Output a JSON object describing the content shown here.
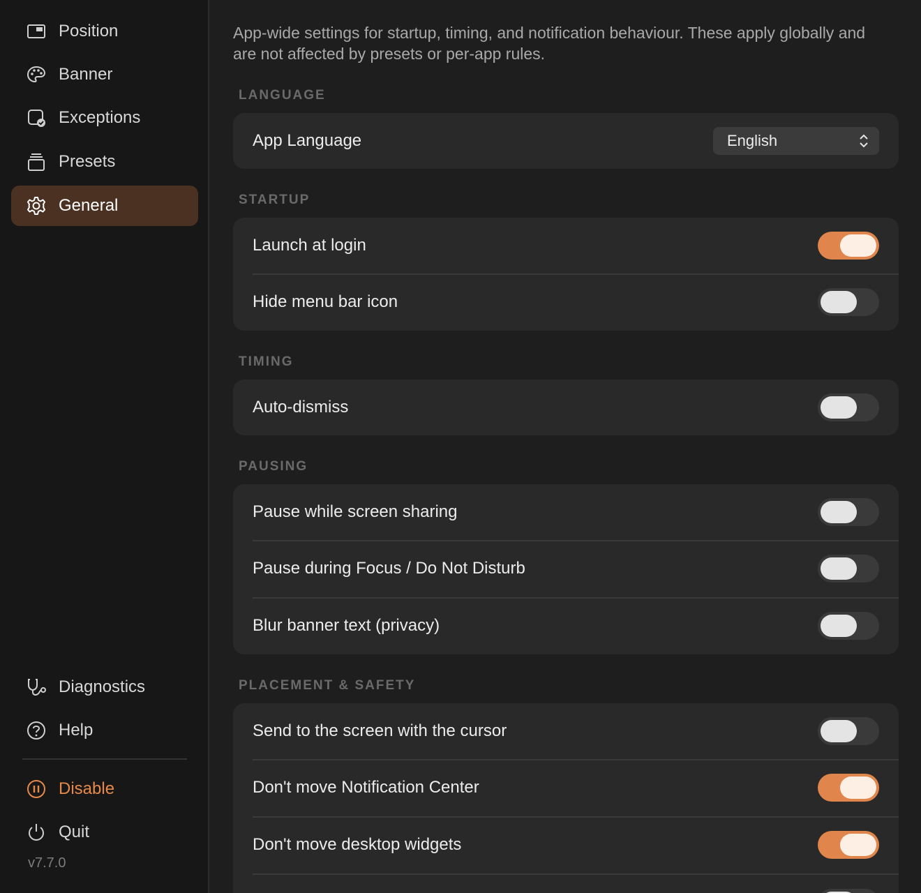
{
  "sidebar": {
    "nav": [
      {
        "label": "Position",
        "icon": "window-position-icon"
      },
      {
        "label": "Banner",
        "icon": "palette-icon"
      },
      {
        "label": "Exceptions",
        "icon": "exceptions-icon"
      },
      {
        "label": "Presets",
        "icon": "stack-icon"
      },
      {
        "label": "General",
        "icon": "gear-icon",
        "active": true
      }
    ],
    "bottom": [
      {
        "label": "Diagnostics",
        "icon": "stethoscope-icon"
      },
      {
        "label": "Help",
        "icon": "help-icon"
      },
      {
        "label": "Disable",
        "icon": "pause-icon"
      },
      {
        "label": "Quit",
        "icon": "power-icon"
      }
    ],
    "version": "v7.7.0"
  },
  "main": {
    "description": "App-wide settings for startup, timing, and notification behaviour. These apply globally and are not affected by presets or per-app rules.",
    "sections": {
      "language": {
        "title": "LANGUAGE",
        "rows": [
          {
            "label": "App Language",
            "select_value": "English"
          }
        ]
      },
      "startup": {
        "title": "STARTUP",
        "rows": [
          {
            "label": "Launch at login",
            "on": true
          },
          {
            "label": "Hide menu bar icon",
            "on": false
          }
        ]
      },
      "timing": {
        "title": "TIMING",
        "rows": [
          {
            "label": "Auto-dismiss",
            "on": false
          }
        ]
      },
      "pausing": {
        "title": "PAUSING",
        "rows": [
          {
            "label": "Pause while screen sharing",
            "on": false
          },
          {
            "label": "Pause during Focus / Do Not Disturb",
            "on": false
          },
          {
            "label": "Blur banner text (privacy)",
            "on": false
          }
        ]
      },
      "placement": {
        "title": "PLACEMENT & SAFETY",
        "rows": [
          {
            "label": "Send to the screen with the cursor",
            "on": false
          },
          {
            "label": "Don't move Notification Center",
            "on": true
          },
          {
            "label": "Don't move desktop widgets",
            "on": true
          }
        ]
      }
    }
  },
  "colors": {
    "accent": "#e0854b",
    "active_nav_bg": "#4a3122",
    "card_bg": "#292929",
    "sidebar_bg": "#171717"
  }
}
